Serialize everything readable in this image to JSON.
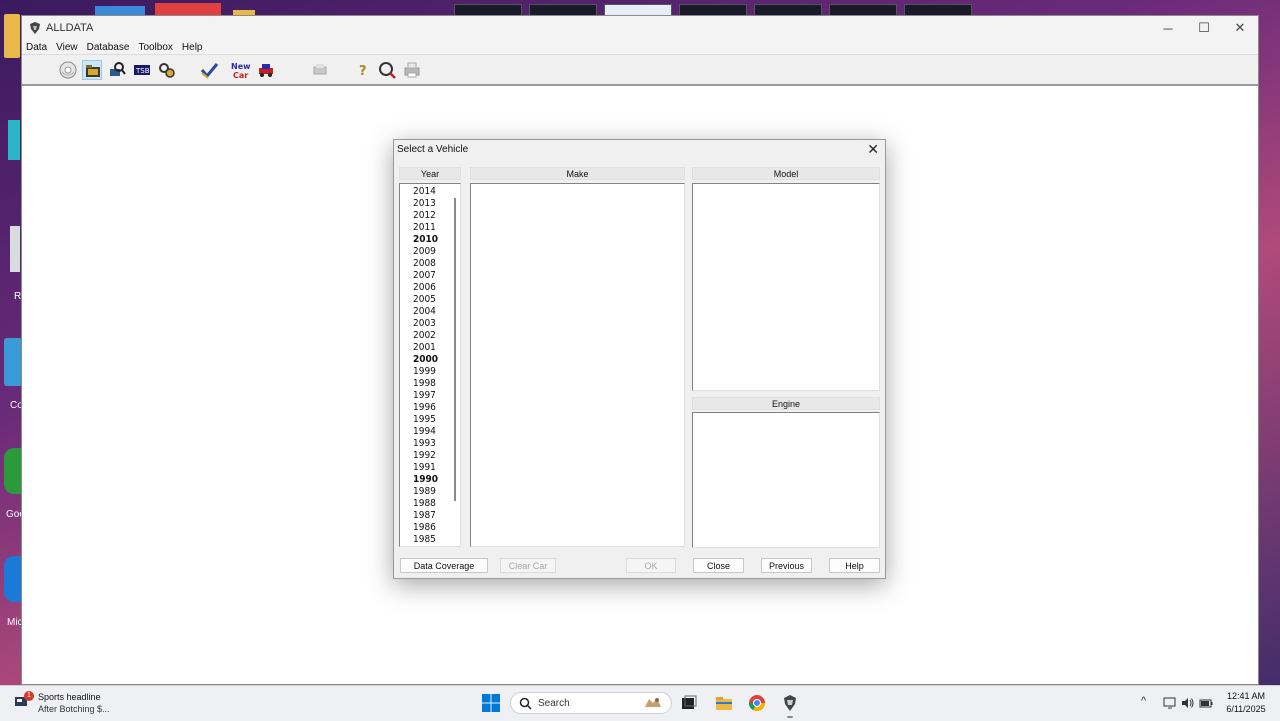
{
  "window": {
    "title": "ALLDATA",
    "controls": {
      "minimize": "─",
      "maximize": "☐",
      "close": "✕"
    }
  },
  "menu": [
    "Data",
    "View",
    "Database",
    "Toolbox",
    "Help"
  ],
  "toolbar": {
    "icons": [
      "disc-icon",
      "folder-icon",
      "search-tools-icon",
      "tsb-icon",
      "gears-icon",
      "checkmark-icon",
      "new-car-icon",
      "car-icon",
      "print-preview-icon",
      "help-key-icon",
      "find-icon",
      "printer-icon"
    ]
  },
  "dialog": {
    "title": "Select a Vehicle",
    "close_glyph": "✕",
    "headers": {
      "year": "Year",
      "make": "Make",
      "model": "Model",
      "engine": "Engine"
    },
    "years": [
      {
        "label": "2014",
        "bold": false
      },
      {
        "label": "2013",
        "bold": false
      },
      {
        "label": "2012",
        "bold": false
      },
      {
        "label": "2011",
        "bold": false
      },
      {
        "label": "2010",
        "bold": true
      },
      {
        "label": "2009",
        "bold": false
      },
      {
        "label": "2008",
        "bold": false
      },
      {
        "label": "2007",
        "bold": false
      },
      {
        "label": "2006",
        "bold": false
      },
      {
        "label": "2005",
        "bold": false
      },
      {
        "label": "2004",
        "bold": false
      },
      {
        "label": "2003",
        "bold": false
      },
      {
        "label": "2002",
        "bold": false
      },
      {
        "label": "2001",
        "bold": false
      },
      {
        "label": "2000",
        "bold": true
      },
      {
        "label": "1999",
        "bold": false
      },
      {
        "label": "1998",
        "bold": false
      },
      {
        "label": "1997",
        "bold": false
      },
      {
        "label": "1996",
        "bold": false
      },
      {
        "label": "1995",
        "bold": false
      },
      {
        "label": "1994",
        "bold": false
      },
      {
        "label": "1993",
        "bold": false
      },
      {
        "label": "1992",
        "bold": false
      },
      {
        "label": "1991",
        "bold": false
      },
      {
        "label": "1990",
        "bold": true
      },
      {
        "label": "1989",
        "bold": false
      },
      {
        "label": "1988",
        "bold": false
      },
      {
        "label": "1987",
        "bold": false
      },
      {
        "label": "1986",
        "bold": false
      },
      {
        "label": "1985",
        "bold": false
      }
    ],
    "buttons": {
      "data_coverage": "Data Coverage",
      "clear_car": "Clear Car",
      "ok": "OK",
      "close": "Close",
      "previous": "Previous",
      "help": "Help"
    }
  },
  "taskbar": {
    "news": {
      "badge": "1",
      "title": "Sports headline",
      "subtitle": "After Botching $..."
    },
    "search": {
      "placeholder": "Search"
    },
    "tray": {
      "chevron": "^",
      "time": "12:41 AM",
      "date": "6/11/2025"
    }
  },
  "desktop": {
    "labels": [
      "R",
      "Co",
      "Goo",
      "Mic"
    ]
  },
  "colors": {
    "accent_blue": "#0078d4",
    "dialog_bg": "#f0f0f0",
    "window_border": "#9a9a9a"
  }
}
